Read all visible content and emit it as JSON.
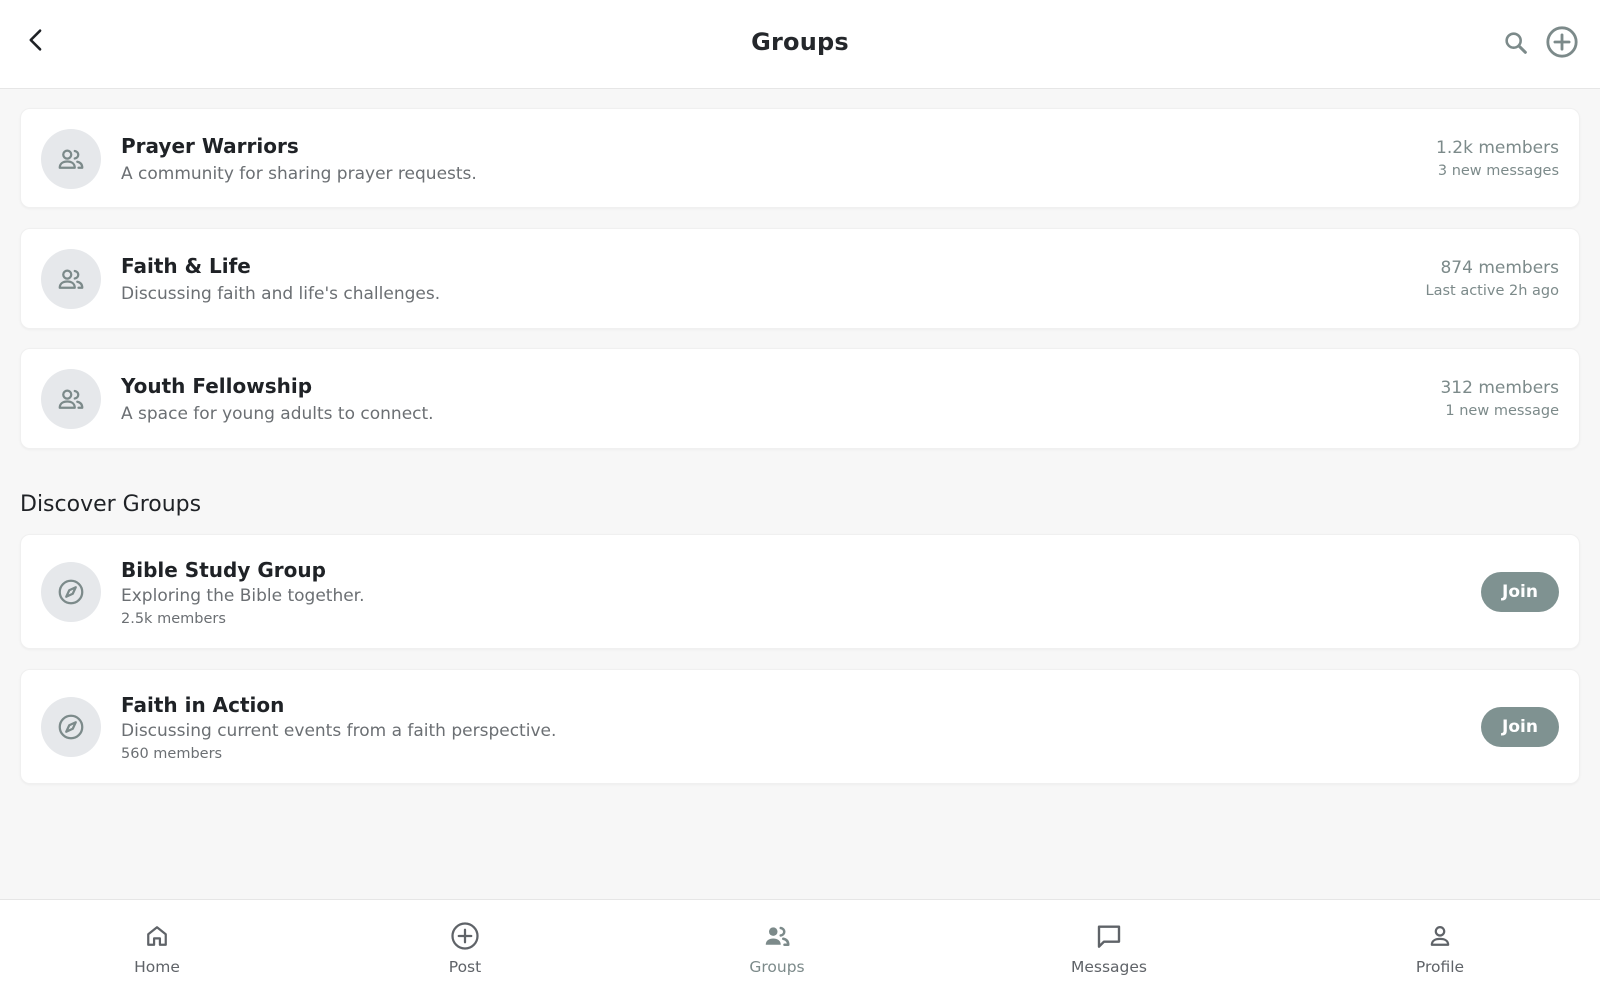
{
  "header": {
    "title": "Groups",
    "back_icon": "chevron-left-icon",
    "search_icon": "search-icon",
    "add_icon": "add-circle-icon"
  },
  "my_groups": [
    {
      "name": "Prayer Warriors",
      "description": "A community for sharing prayer requests.",
      "members": "1.2k members",
      "status": "3 new messages",
      "icon": "group-icon"
    },
    {
      "name": "Faith & Life",
      "description": "Discussing faith and life's challenges.",
      "members": "874 members",
      "status": "Last active 2h ago",
      "icon": "group-icon"
    },
    {
      "name": "Youth Fellowship",
      "description": "A space for young adults to connect.",
      "members": "312 members",
      "status": "1 new message",
      "icon": "group-icon"
    }
  ],
  "discover": {
    "title": "Discover Groups",
    "groups": [
      {
        "name": "Bible Study Group",
        "description": "Exploring the Bible together.",
        "members": "2.5k members",
        "action": "Join",
        "icon": "compass-icon"
      },
      {
        "name": "Faith in Action",
        "description": "Discussing current events from a faith perspective.",
        "members": "560 members",
        "action": "Join",
        "icon": "compass-icon"
      }
    ]
  },
  "bottom_nav": {
    "active": "Groups",
    "items": [
      {
        "label": "Home",
        "icon": "home-icon"
      },
      {
        "label": "Post",
        "icon": "add-circle-icon"
      },
      {
        "label": "Groups",
        "icon": "group-icon"
      },
      {
        "label": "Messages",
        "icon": "chat-icon"
      },
      {
        "label": "Profile",
        "icon": "person-icon"
      }
    ]
  },
  "colors": {
    "accent": "#7f9291",
    "meta_text": "#7c8a8a",
    "avatar_bg": "#e6e8eb",
    "background": "#f7f7f7"
  }
}
